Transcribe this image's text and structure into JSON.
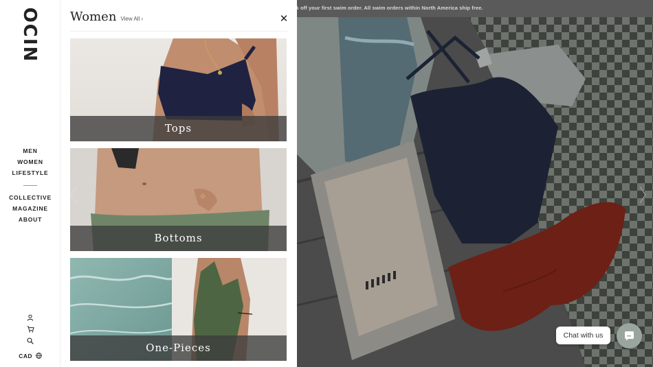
{
  "brand": {
    "logo": "OCIN"
  },
  "nav": {
    "primary": [
      {
        "label": "MEN"
      },
      {
        "label": "WOMEN"
      },
      {
        "label": "LIFESTYLE"
      }
    ],
    "secondary": [
      {
        "label": "COLLECTIVE"
      },
      {
        "label": "MAGAZINE"
      },
      {
        "label": "ABOUT"
      }
    ]
  },
  "utilities": {
    "account_icon": "user-icon",
    "cart_icon": "cart-icon",
    "search_icon": "search-icon",
    "currency": "CAD",
    "currency_icon": "globe-icon"
  },
  "menu": {
    "title": "Women",
    "view_all": "View All ›",
    "close_icon": "close-icon",
    "categories": [
      {
        "label": "Tops"
      },
      {
        "label": "Bottoms"
      },
      {
        "label": "One-Pieces"
      }
    ]
  },
  "announcement": {
    "text": "% off your first swim order. All swim orders within North America ship free."
  },
  "chat": {
    "label": "Chat with us",
    "icon": "chat-bubble-icon"
  },
  "colors": {
    "overlay_label": "#3c3c3c",
    "chat_button": "#9aa69d",
    "announcement_bar": "#5a5a5a"
  }
}
